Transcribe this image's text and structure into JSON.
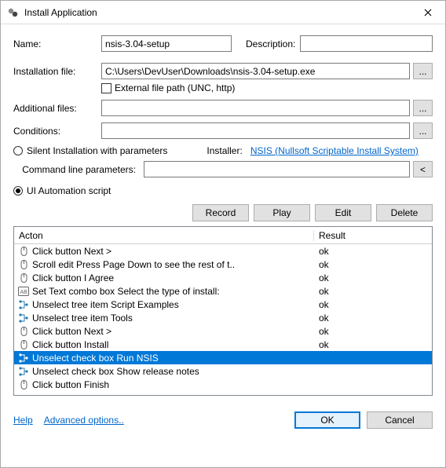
{
  "window": {
    "title": "Install Application"
  },
  "labels": {
    "name": "Name:",
    "description": "Description:",
    "installation_file": "Installation file:",
    "external_file_path": "External file path (UNC, http)",
    "additional_files": "Additional files:",
    "conditions": "Conditions:",
    "silent_install": "Silent Installation with parameters",
    "installer_prefix": "Installer:",
    "installer_link": "NSIS (Nullsoft Scriptable Install System)",
    "command_line_params": "Command line parameters:",
    "ui_automation": "UI Automation script",
    "help": "Help",
    "advanced": "Advanced options.."
  },
  "fields": {
    "name": "nsis-3.04-setup",
    "description": "",
    "installation_file": "C:\\Users\\DevUser\\Downloads\\nsis-3.04-setup.exe",
    "additional_files": "",
    "conditions": "",
    "command_line": ""
  },
  "buttons": {
    "browse": "...",
    "angle": "<",
    "record": "Record",
    "play": "Play",
    "edit": "Edit",
    "delete": "Delete",
    "ok": "OK",
    "cancel": "Cancel"
  },
  "grid": {
    "head_action": "Acton",
    "head_result": "Result",
    "rows": [
      {
        "icon": "mouse",
        "action": "Click button Next >",
        "result": "ok",
        "selected": false
      },
      {
        "icon": "mouse",
        "action": "Scroll edit Press Page Down to see the rest of t..",
        "result": "ok",
        "selected": false
      },
      {
        "icon": "mouse",
        "action": "Click button I Agree",
        "result": "ok",
        "selected": false
      },
      {
        "icon": "text",
        "action": "Set Text combo box Select the type of install:",
        "result": "ok",
        "selected": false
      },
      {
        "icon": "tree",
        "action": "Unselect tree item Script Examples",
        "result": "ok",
        "selected": false
      },
      {
        "icon": "tree",
        "action": "Unselect tree item Tools",
        "result": "ok",
        "selected": false
      },
      {
        "icon": "mouse",
        "action": "Click button Next >",
        "result": "ok",
        "selected": false
      },
      {
        "icon": "mouse",
        "action": "Click button Install",
        "result": "ok",
        "selected": false
      },
      {
        "icon": "tree",
        "action": "Unselect check box Run NSIS",
        "result": "",
        "selected": true
      },
      {
        "icon": "tree",
        "action": "Unselect check box Show release notes",
        "result": "",
        "selected": false
      },
      {
        "icon": "mouse",
        "action": "Click button Finish",
        "result": "",
        "selected": false
      }
    ]
  }
}
